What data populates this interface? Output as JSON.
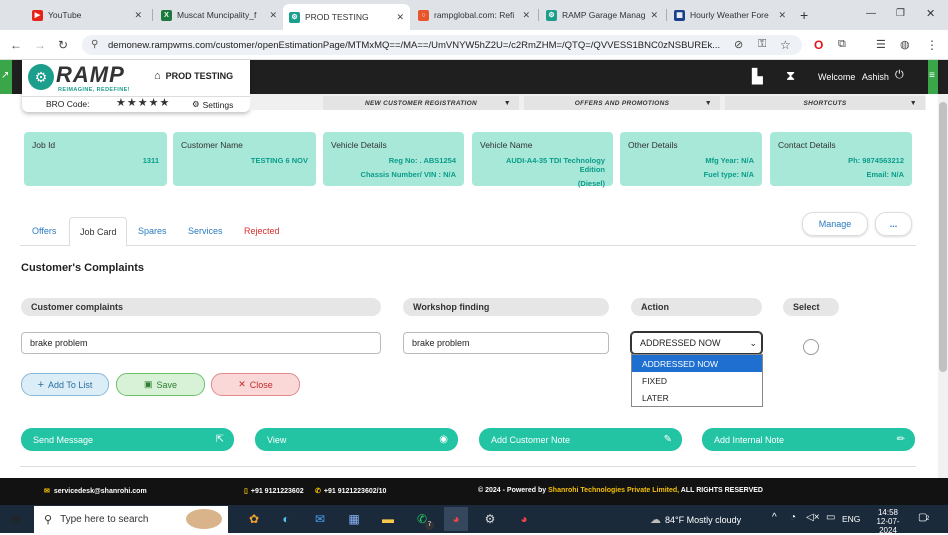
{
  "browser": {
    "tabs": [
      {
        "label": "YouTube",
        "favicon_color": "#e62117",
        "active": false
      },
      {
        "label": "Muscat Muncipality_f",
        "favicon_color": "#1d7a3e",
        "active": false
      },
      {
        "label": "PROD TESTING",
        "favicon_color": "#1b9e8c",
        "active": true
      },
      {
        "label": "rampglobal.com: Refi",
        "favicon_color": "#e8552b",
        "active": false
      },
      {
        "label": "RAMP Garage Manag",
        "favicon_color": "#1b9e8c",
        "active": false
      },
      {
        "label": "Hourly Weather Fore",
        "favicon_color": "#1a3f8c",
        "active": false
      }
    ],
    "url": "demonew.rampwms.com/customer/openEstimationPage/MTMxMQ==/MA==/UmVNYW5hZ2U=/c2RmZHM=/QTQ=/QVVESS1BNC0zNSBUREk..."
  },
  "app": {
    "logo_text": "RAMP",
    "tagline": "REIMAGINE, REDEFINE!",
    "page_title": "PROD TESTING",
    "bro_code_label": "BRO Code:",
    "rating": 5,
    "settings_label": "Settings",
    "welcome_label": "Welcome",
    "user_name": "Ashish"
  },
  "subnav": [
    {
      "label": "NEW CUSTOMER REGISTRATION"
    },
    {
      "label": "OFFERS AND PROMOTIONS"
    },
    {
      "label": "SHORTCUTS"
    }
  ],
  "cards": {
    "job": {
      "label": "Job Id",
      "value": "1311"
    },
    "customer": {
      "label": "Customer Name",
      "value": "TESTING 6 NOV"
    },
    "vehicle_details": {
      "label": "Vehicle Details",
      "line1": "Reg No: . ABS1254",
      "line2": "Chassis Number/ VIN : N/A"
    },
    "vehicle_name": {
      "label": "Vehicle Name",
      "line1": "AUDI-A4-35 TDI Technology Edition",
      "line2": "(Diesel)"
    },
    "other": {
      "label": "Other Details",
      "line1": "Mfg Year: N/A",
      "line2": "Fuel type: N/A"
    },
    "contact": {
      "label": "Contact Details",
      "line1": "Ph: 9874563212",
      "line2": "Email: N/A"
    }
  },
  "page_tabs": [
    {
      "label": "Offers"
    },
    {
      "label": "Job Card"
    },
    {
      "label": "Spares"
    },
    {
      "label": "Services"
    },
    {
      "label": "Rejected"
    }
  ],
  "manage_label": "Manage",
  "more_label": "...",
  "section_title": "Customer's Complaints",
  "columns": {
    "complaints": "Customer complaints",
    "finding": "Workshop finding",
    "action": "Action",
    "select": "Select"
  },
  "row": {
    "complaint": "brake problem",
    "finding": "brake problem",
    "action": "ADDRESSED NOW"
  },
  "action_options": [
    "ADDRESSED NOW",
    "FIXED",
    "LATER"
  ],
  "buttons": {
    "add_to_list": "Add To List",
    "save": "Save",
    "close": "Close"
  },
  "actions": {
    "send_message": "Send Message",
    "view": "View",
    "add_customer_note": "Add Customer Note",
    "add_internal_note": "Add Internal Note"
  },
  "footer": {
    "email": "servicedesk@shanrohi.com",
    "phone1": "+91 9121223602",
    "phone2": "+91 9121223602/10",
    "copyright_prefix": "© 2024 - Powered by",
    "company": "Shanrohi Technologies Private Limited,",
    "rights": "ALL RIGHTS RESERVED"
  },
  "taskbar": {
    "search_placeholder": "Type here to search",
    "weather": "84°F  Mostly cloudy",
    "lang": "ENG",
    "time": "14:58",
    "date": "12-07-2024",
    "whatsapp_badge": "7",
    "notif_count": "2"
  },
  "colors": {
    "accent": "#22c4a4",
    "card_bg": "#a7e8d8",
    "header_bg": "#1f1f1f",
    "danger": "#e03030"
  }
}
